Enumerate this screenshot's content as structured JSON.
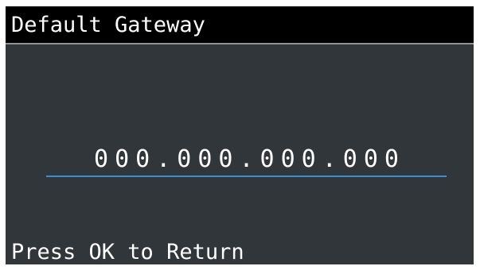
{
  "title": "Default Gateway",
  "gateway": {
    "value": "000.000.000.000"
  },
  "footer": {
    "hint": "Press OK to Return"
  },
  "colors": {
    "background": "#31363b",
    "title_bar": "#000000",
    "text": "#ffffff",
    "field_underline": "#3b8fd0"
  }
}
